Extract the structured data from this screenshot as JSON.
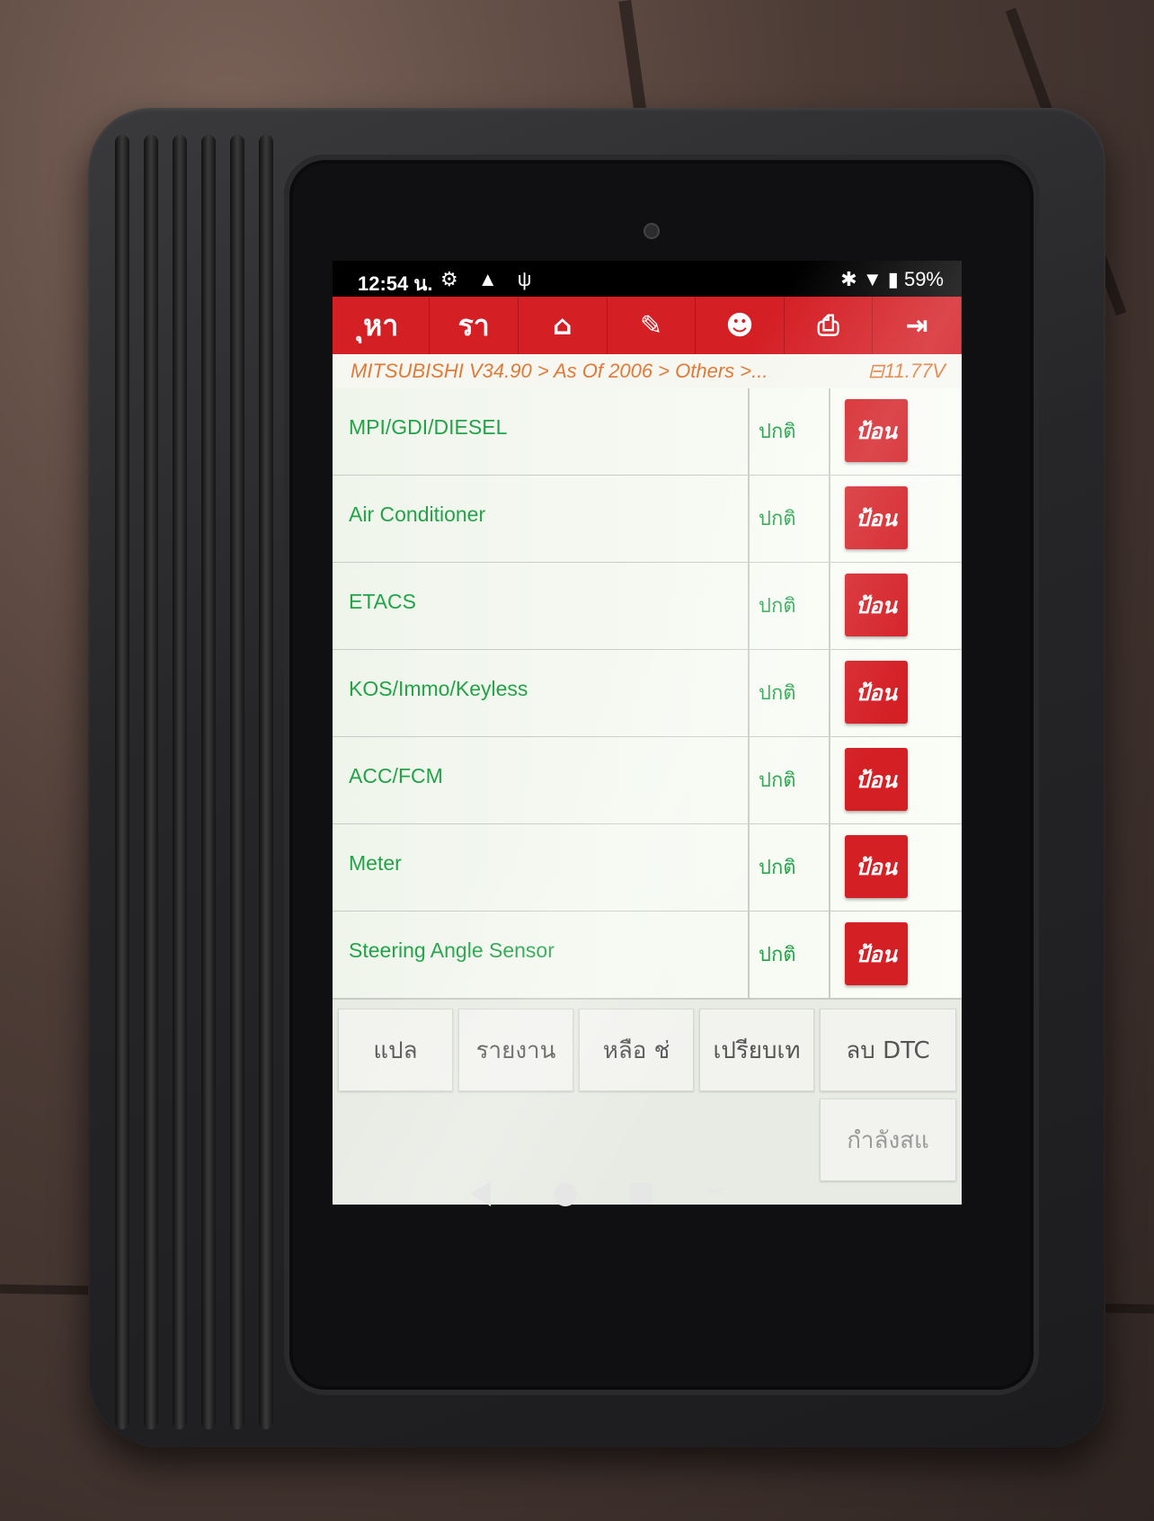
{
  "status_bar": {
    "time": "12:54 น.",
    "left_icons": "⚙ ▲ ψ",
    "right_icons": "✱ ▼ ▮",
    "battery": "59%"
  },
  "toolbar": {
    "items": [
      {
        "label": "ุหา",
        "icon": "search-text"
      },
      {
        "label": "รา",
        "icon": "text"
      },
      {
        "label": "⌂",
        "icon": "home-icon"
      },
      {
        "label": "✎",
        "icon": "edit-icon"
      },
      {
        "label": "☻",
        "icon": "user-icon"
      },
      {
        "label": "⎙",
        "icon": "print-icon"
      },
      {
        "label": "⇥",
        "icon": "exit-icon"
      }
    ]
  },
  "breadcrumb": "MITSUBISHI V34.90 > As Of 2006 > Others >...",
  "voltage": "11.77V",
  "systems": [
    {
      "name": "MPI/GDI/DIESEL",
      "status": "ปกติ",
      "button": "ป้อน"
    },
    {
      "name": "Air Conditioner",
      "status": "ปกติ",
      "button": "ป้อน"
    },
    {
      "name": "ETACS",
      "status": "ปกติ",
      "button": "ป้อน"
    },
    {
      "name": "KOS/Immo/Keyless",
      "status": "ปกติ",
      "button": "ป้อน"
    },
    {
      "name": "ACC/FCM",
      "status": "ปกติ",
      "button": "ป้อน"
    },
    {
      "name": "Meter",
      "status": "ปกติ",
      "button": "ป้อน"
    },
    {
      "name": "Steering Angle Sensor",
      "status": "ปกติ",
      "button": "ป้อน"
    }
  ],
  "function_buttons": {
    "translate": "แปล",
    "report": "รายงาน",
    "help": "หลือ ช่",
    "compare": "เปรียบเท",
    "clear_dtc": "ลบ DTC",
    "progress": "กำลังสแ"
  },
  "colors": {
    "toolbar_red": "#d41f25",
    "item_green": "#22a348",
    "breadcrumb_orange": "#e07a38"
  }
}
